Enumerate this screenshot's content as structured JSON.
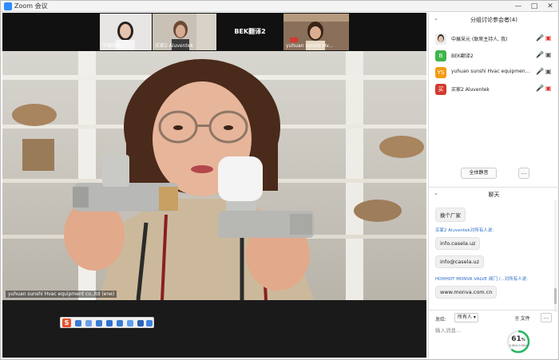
{
  "window": {
    "title": "Zoom 会议",
    "accent": "#2d8cff"
  },
  "thumbnails": [
    {
      "label": "中展采元"
    },
    {
      "label": "买家2 Aluventek"
    },
    {
      "label": "BEK翻译2"
    },
    {
      "label": "yuhuan sunshi Hv..."
    }
  ],
  "main_video": {
    "speaker_label": "yuhuan sunshi Hvac equipment co.,ltd (ene)"
  },
  "ime_toolbar": {
    "logo": "S"
  },
  "participants_panel": {
    "title": "分组讨论参会者(4)",
    "participants": [
      {
        "name": "中展采元 (联席主持人, 我)",
        "avatar": "",
        "avatar_color": "#c9a38c",
        "mic": "muted",
        "cam": "off"
      },
      {
        "name": "BEK翻译2",
        "avatar": "B",
        "avatar_color": "#3fb54a",
        "mic": "on",
        "cam": "on"
      },
      {
        "name": "yuhuan sunshi Hvac equipment c...",
        "avatar": "YS",
        "avatar_color": "#f39c12",
        "mic": "on",
        "cam": "on"
      },
      {
        "name": "买家2 Aluventek",
        "avatar": "买",
        "avatar_color": "#d33a2c",
        "mic": "on",
        "cam": "off"
      }
    ],
    "mute_all_label": "全体静音",
    "more_label": "..."
  },
  "chat": {
    "title": "聊天",
    "messages": [
      {
        "type": "bubble",
        "text": "换个厂家"
      },
      {
        "type": "sender",
        "text": "买家2 Aluventek对所有人说:"
      },
      {
        "type": "bubble",
        "text": "info.casela.uz"
      },
      {
        "type": "bubble",
        "text": "info@casela.uz"
      },
      {
        "type": "sender",
        "text": "HOHHOT MONVA VALVE 阀门 /...对所有人说:"
      },
      {
        "type": "bubble",
        "text": "www.monva.com.cn"
      }
    ],
    "send_to_label": "发给:",
    "send_to_value": "所有人",
    "file_label": "文件",
    "more_label": "...",
    "input_placeholder": "输入消息..."
  },
  "network": {
    "percent": 61,
    "percent_unit": "%",
    "speed": "0.0K/s 0.0K/s"
  }
}
